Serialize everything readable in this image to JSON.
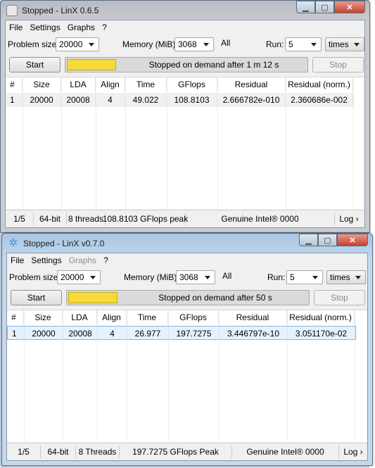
{
  "windows": [
    {
      "title": "Stopped - LinX 0.6.5",
      "menu": [
        {
          "label": "File",
          "disabled": false
        },
        {
          "label": "Settings",
          "disabled": false
        },
        {
          "label": "Graphs",
          "disabled": false
        },
        {
          "label": "?",
          "disabled": false
        }
      ],
      "controls": {
        "problem_size_label": "Problem size:",
        "problem_size_value": "20000",
        "memory_label": "Memory (MiB):",
        "memory_value": "3068",
        "all_label": "All",
        "run_label": "Run:",
        "run_value": "5",
        "times_value": "times",
        "start_label": "Start",
        "stop_label": "Stop",
        "progress_text": "Stopped on demand after 1 m 12 s",
        "progress_color": "#f4db3b"
      },
      "table": {
        "headers": [
          "#",
          "Size",
          "LDA",
          "Align",
          "Time",
          "GFlops",
          "Residual",
          "Residual (norm.)"
        ],
        "rows": [
          [
            "1",
            "20000",
            "20008",
            "4",
            "49.022",
            "108.8103",
            "2.666782e-010",
            "2.360686e-002"
          ]
        ]
      },
      "status": [
        "1/5",
        "64-bit",
        "8 threads",
        "108.8103 GFlops peak",
        "Genuine Intel® 0000",
        "Log ›"
      ]
    },
    {
      "title": "Stopped - LinX v0.7.0",
      "menu": [
        {
          "label": "File",
          "disabled": false
        },
        {
          "label": "Settings",
          "disabled": false
        },
        {
          "label": "Graphs",
          "disabled": true
        },
        {
          "label": "?",
          "disabled": false
        }
      ],
      "controls": {
        "problem_size_label": "Problem size:",
        "problem_size_value": "20000",
        "memory_label": "Memory (MiB):",
        "memory_value": "3068",
        "all_label": "All",
        "run_label": "Run:",
        "run_value": "5",
        "times_value": "times",
        "start_label": "Start",
        "stop_label": "Stop",
        "progress_text": "Stopped on demand after 50 s",
        "progress_color": "#f4db3b"
      },
      "table": {
        "headers": [
          "#",
          "Size",
          "LDA",
          "Align",
          "Time",
          "GFlops",
          "Residual",
          "Residual (norm.)"
        ],
        "rows": [
          [
            "1",
            "20000",
            "20008",
            "4",
            "26.977",
            "197.7275",
            "3.446797e-10",
            "3.051170e-02"
          ]
        ]
      },
      "status": [
        "1/5",
        "64-bit",
        "8 Threads",
        "197.7275 GFlops Peak",
        "Genuine Intel® 0000",
        "Log ›"
      ]
    }
  ],
  "icons": {
    "app_icon_old": "checkbox-app-icon",
    "app_icon_new": "linx-gear-icon",
    "minimize": "minimize-icon",
    "maximize": "maximize-icon",
    "close": "close-icon",
    "dropdown": "chevron-down-icon"
  }
}
